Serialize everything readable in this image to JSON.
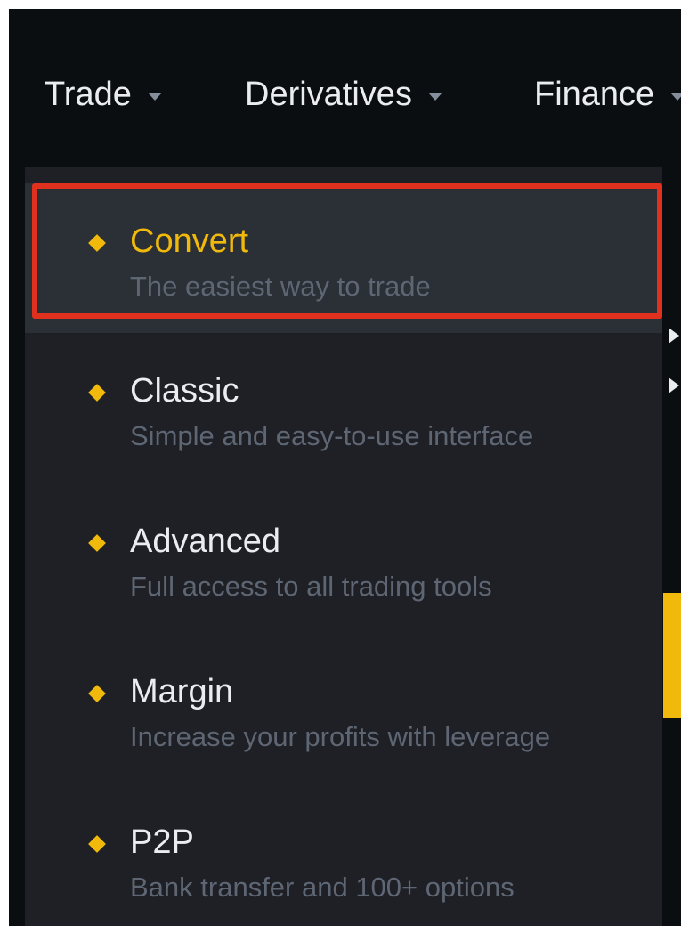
{
  "nav": {
    "items": [
      {
        "label": "Trade"
      },
      {
        "label": "Derivatives"
      },
      {
        "label": "Finance"
      }
    ]
  },
  "dropdown": {
    "items": [
      {
        "title": "Convert",
        "description": "The easiest way to trade",
        "highlighted": true
      },
      {
        "title": "Classic",
        "description": "Simple and easy-to-use interface"
      },
      {
        "title": "Advanced",
        "description": "Full access to all trading tools"
      },
      {
        "title": "Margin",
        "description": "Increase your profits with leverage"
      },
      {
        "title": "P2P",
        "description": "Bank transfer and 100+ options"
      }
    ]
  },
  "colors": {
    "background": "#0b0e11",
    "dropdown": "#1e2026",
    "accent": "#f0b90b",
    "highlight_border": "#e0301e"
  },
  "icons": {
    "menu_bullet": "diamond-icon",
    "nav_caret": "caret-down-icon"
  }
}
